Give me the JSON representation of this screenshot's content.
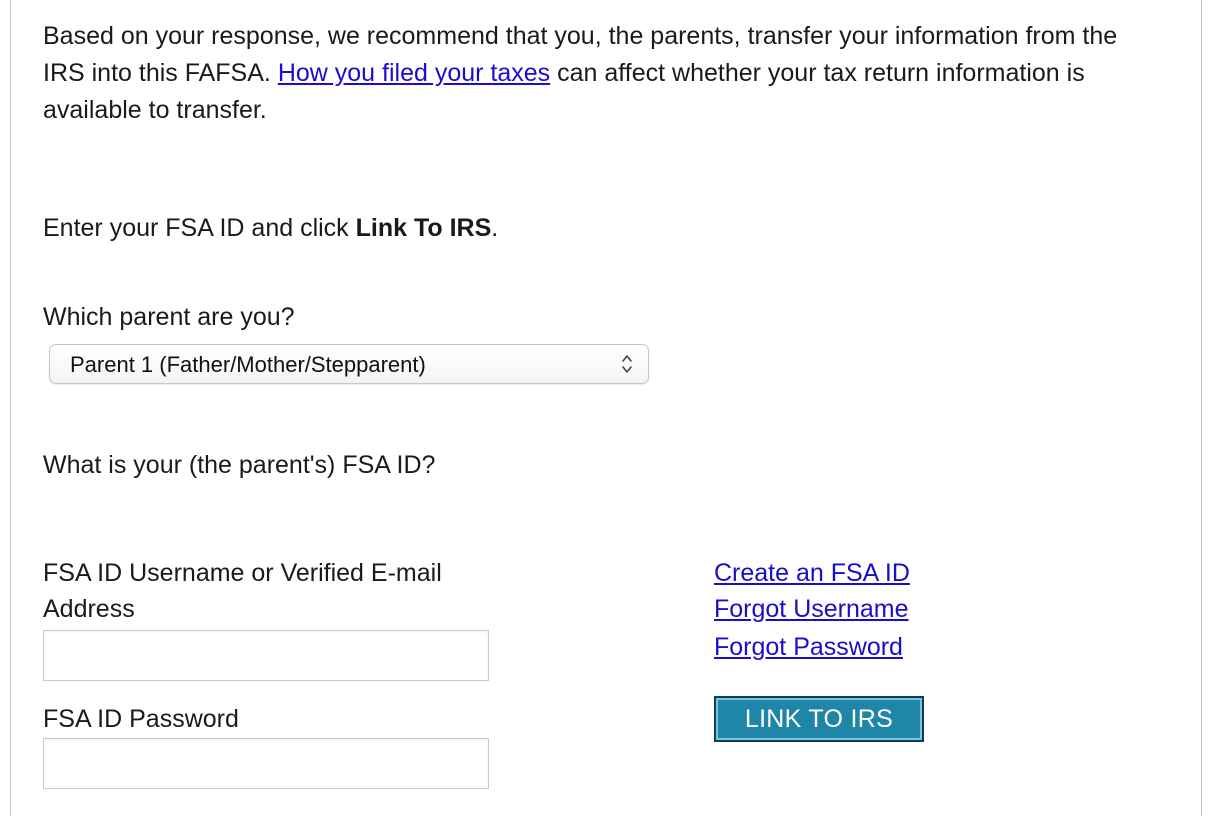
{
  "intro": {
    "before_link": "Based on your response, we recommend that you, the parents, transfer your information from the IRS into this FAFSA. ",
    "link_text": "How you filed your taxes",
    "after_link": " can affect whether your tax return information is available to transfer."
  },
  "instruction": {
    "prefix": "Enter your FSA ID and click ",
    "bold": "Link To IRS",
    "suffix": "."
  },
  "parent_question": "Which parent are you?",
  "parent_select": {
    "selected": "Parent 1 (Father/Mother/Stepparent)"
  },
  "fsa_question": "What is your (the parent's) FSA ID?",
  "username_field": {
    "label_line1": "FSA ID Username or Verified E-mail",
    "label_line2": "Address",
    "value": ""
  },
  "password_field": {
    "label": "FSA ID Password",
    "value": ""
  },
  "links": {
    "create": "Create an FSA ID",
    "forgot_username": "Forgot Username",
    "forgot_password": "Forgot Password"
  },
  "link_button_label": "LINK TO IRS",
  "colors": {
    "link": "#1a0dcc",
    "button_bg": "#1f86a8",
    "button_border": "#0b3f55"
  },
  "icons": {
    "select_arrows": "chevron-up-down-icon"
  }
}
